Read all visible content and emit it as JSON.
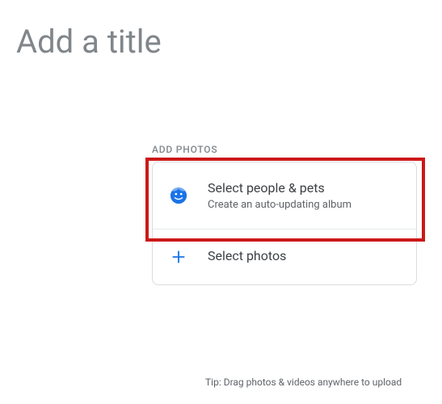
{
  "title_placeholder": "Add a title",
  "section_label": "ADD PHOTOS",
  "options": {
    "people_pets": {
      "title": "Select people & pets",
      "subtitle": "Create an auto-updating album"
    },
    "select_photos": {
      "title": "Select photos"
    }
  },
  "tip": "Tip: Drag photos & videos anywhere to upload",
  "colors": {
    "accent_blue": "#1a73e8",
    "highlight_red": "#cc1818"
  }
}
